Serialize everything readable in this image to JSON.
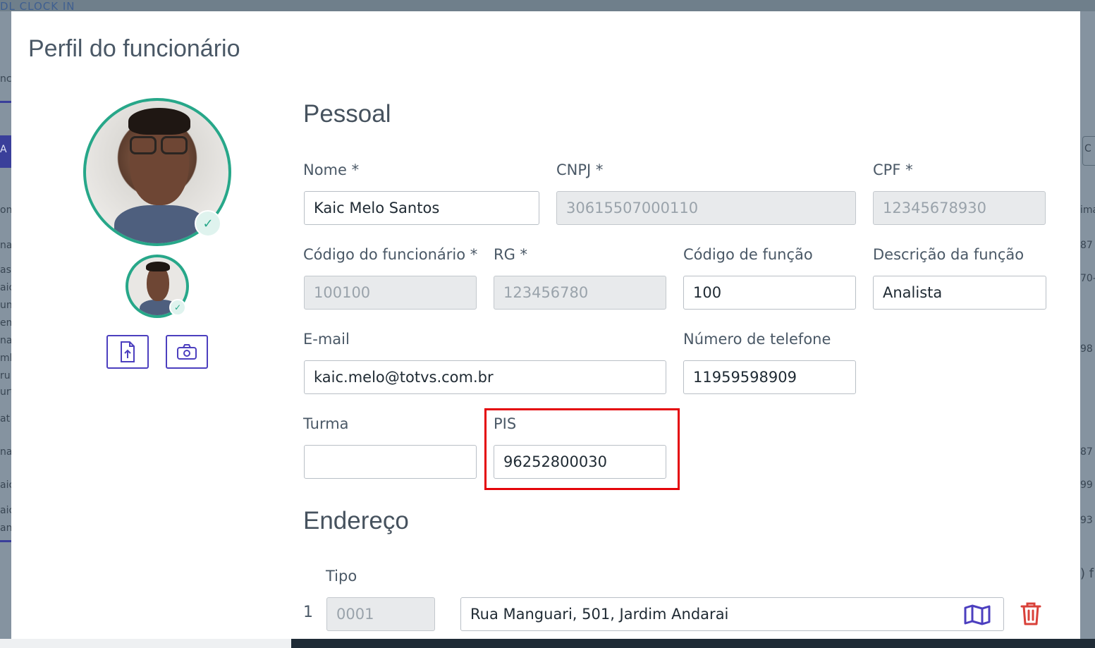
{
  "background": {
    "topbar_text": "DL   CLOCK IN",
    "left_fragments": [
      "nc",
      "A",
      "on",
      "na",
      "as",
      "aic",
      "un",
      "em",
      "na",
      "mb",
      "ru",
      "urt",
      "at",
      "na",
      "aic",
      "aic",
      "an"
    ],
    "right_fragments": [
      "C",
      "ima",
      "87",
      "70-",
      "98",
      "87",
      "99",
      "93",
      ") f"
    ]
  },
  "modal": {
    "title": "Perfil do funcionário"
  },
  "avatar": {
    "upload_icon": "file-upload-icon",
    "camera_icon": "camera-icon",
    "status_icon": "check-icon"
  },
  "personal": {
    "section_title": "Pessoal",
    "nome": {
      "label": "Nome *",
      "value": "Kaic Melo Santos"
    },
    "cnpj": {
      "label": "CNPJ *",
      "value": "30615507000110"
    },
    "cpf": {
      "label": "CPF *",
      "value": "12345678930"
    },
    "codigo_funcionario": {
      "label": "Código do funcionário *",
      "value": "100100"
    },
    "rg": {
      "label": "RG *",
      "value": "123456780"
    },
    "codigo_funcao": {
      "label": "Código de função",
      "value": "100"
    },
    "descricao_funcao": {
      "label": "Descrição da função",
      "value": "Analista"
    },
    "email": {
      "label": "E-mail",
      "value": "kaic.melo@totvs.com.br"
    },
    "telefone": {
      "label": "Número de telefone",
      "value": "11959598909"
    },
    "turma": {
      "label": "Turma",
      "value": ""
    },
    "pis": {
      "label": "PIS",
      "value": "96252800030"
    }
  },
  "address": {
    "section_title": "Endereço",
    "tipo_label": "Tipo",
    "rows": [
      {
        "index": "1",
        "tipo": "0001",
        "address": "Rua Manguari, 501, Jardim Andarai",
        "map_icon": "map-icon",
        "delete_icon": "trash-icon"
      }
    ]
  },
  "colors": {
    "accent": "#4c3fbf",
    "avatar_ring": "#27a789",
    "highlight": "#e4060b",
    "danger": "#d9413a"
  }
}
